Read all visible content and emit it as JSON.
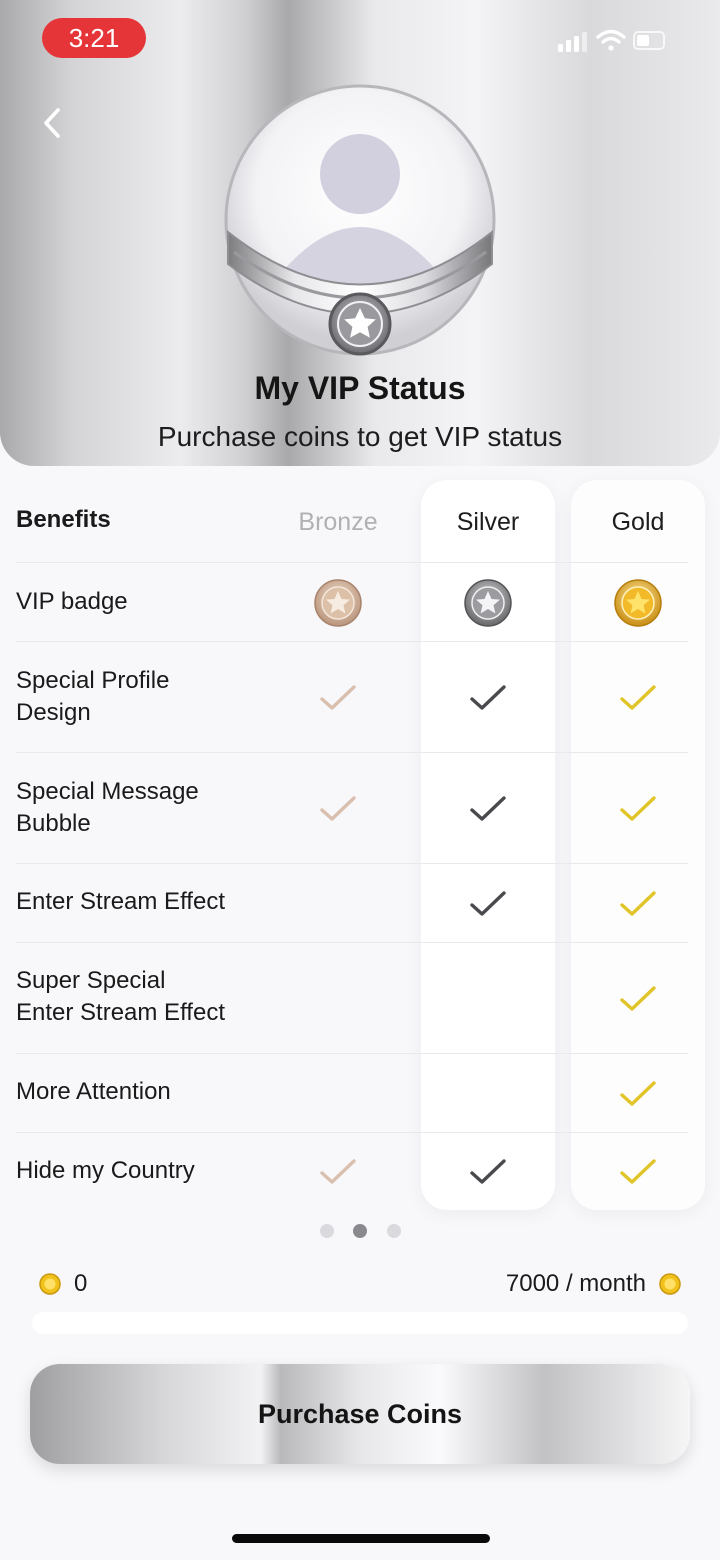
{
  "status_bar": {
    "time": "3:21"
  },
  "header": {
    "title": "My VIP Status",
    "subtitle": "Purchase coins to get VIP status"
  },
  "table": {
    "header_label": "Benefits",
    "tiers": [
      "Bronze",
      "Silver",
      "Gold"
    ],
    "rows": [
      {
        "label_lines": [
          "VIP badge"
        ],
        "bronze": "badge",
        "silver": "badge",
        "gold": "badge"
      },
      {
        "label_lines": [
          "Special Profile",
          "Design"
        ],
        "bronze": "check",
        "silver": "check",
        "gold": "check"
      },
      {
        "label_lines": [
          "Special Message",
          "Bubble"
        ],
        "bronze": "check",
        "silver": "check",
        "gold": "check"
      },
      {
        "label_lines": [
          "Enter Stream Effect"
        ],
        "bronze": "none",
        "silver": "check",
        "gold": "check"
      },
      {
        "label_lines": [
          "Super Special",
          "Enter Stream Effect"
        ],
        "bronze": "none",
        "silver": "none",
        "gold": "check"
      },
      {
        "label_lines": [
          "More Attention"
        ],
        "bronze": "none",
        "silver": "none",
        "gold": "check"
      },
      {
        "label_lines": [
          "Hide my Country"
        ],
        "bronze": "check",
        "silver": "check",
        "gold": "check"
      }
    ]
  },
  "pager": {
    "count": 3,
    "active_index": 1
  },
  "coins": {
    "current": "0",
    "target": "7000 / month",
    "progress_fraction": 0
  },
  "purchase_button": {
    "label": "Purchase Coins"
  },
  "colors": {
    "bronze_check": "#d9bfae",
    "silver_check": "#4a4a4e",
    "gold_check": "#e0c428",
    "time_pill": "#e53538",
    "coin": "#f2c21c"
  },
  "icons": {
    "back": "chevron-left-icon",
    "signal": "cellular-signal-icon",
    "wifi": "wifi-icon",
    "battery": "battery-icon",
    "avatar": "default-avatar-icon",
    "badge": "star-badge-icon",
    "check": "checkmark-icon",
    "coin": "coin-icon"
  }
}
